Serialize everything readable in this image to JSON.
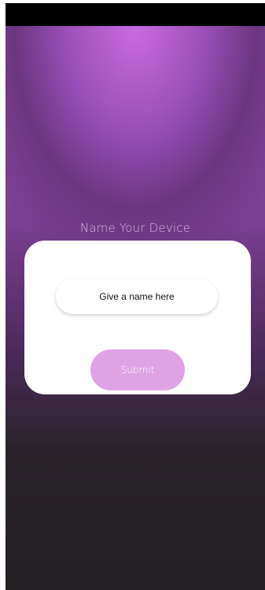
{
  "page": {
    "title": "Name Your Device"
  },
  "form": {
    "name_input": {
      "value": "",
      "placeholder": "Give a name here"
    },
    "submit_label": "Submit"
  },
  "colors": {
    "accent": "#c96be3",
    "button": "#dfa3e4",
    "background_dark": "#242024",
    "card": "#ffffff"
  }
}
